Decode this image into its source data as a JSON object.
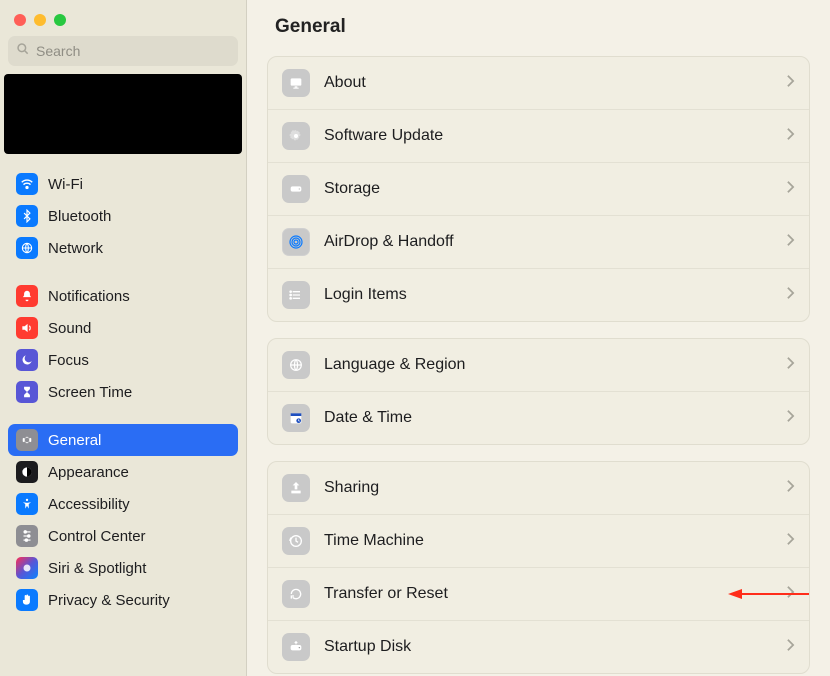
{
  "search": {
    "placeholder": "Search"
  },
  "sidebar": {
    "group1": [
      {
        "id": "wifi",
        "label": "Wi-Fi"
      },
      {
        "id": "bluetooth",
        "label": "Bluetooth"
      },
      {
        "id": "network",
        "label": "Network"
      }
    ],
    "group2": [
      {
        "id": "notifications",
        "label": "Notifications"
      },
      {
        "id": "sound",
        "label": "Sound"
      },
      {
        "id": "focus",
        "label": "Focus"
      },
      {
        "id": "screentime",
        "label": "Screen Time"
      }
    ],
    "group3": [
      {
        "id": "general",
        "label": "General",
        "selected": true
      },
      {
        "id": "appearance",
        "label": "Appearance"
      },
      {
        "id": "accessibility",
        "label": "Accessibility"
      },
      {
        "id": "controlcenter",
        "label": "Control Center"
      },
      {
        "id": "siri",
        "label": "Siri & Spotlight"
      },
      {
        "id": "privacy",
        "label": "Privacy & Security"
      }
    ]
  },
  "page": {
    "title": "General",
    "groups": [
      [
        {
          "id": "about",
          "label": "About"
        },
        {
          "id": "softwareupdate",
          "label": "Software Update"
        },
        {
          "id": "storage",
          "label": "Storage"
        },
        {
          "id": "airdrop",
          "label": "AirDrop & Handoff"
        },
        {
          "id": "loginitems",
          "label": "Login Items"
        }
      ],
      [
        {
          "id": "language",
          "label": "Language & Region"
        },
        {
          "id": "datetime",
          "label": "Date & Time"
        }
      ],
      [
        {
          "id": "sharing",
          "label": "Sharing"
        },
        {
          "id": "timemachine",
          "label": "Time Machine"
        },
        {
          "id": "transfer",
          "label": "Transfer or Reset",
          "annotated": true
        },
        {
          "id": "startupdisk",
          "label": "Startup Disk"
        }
      ]
    ]
  }
}
